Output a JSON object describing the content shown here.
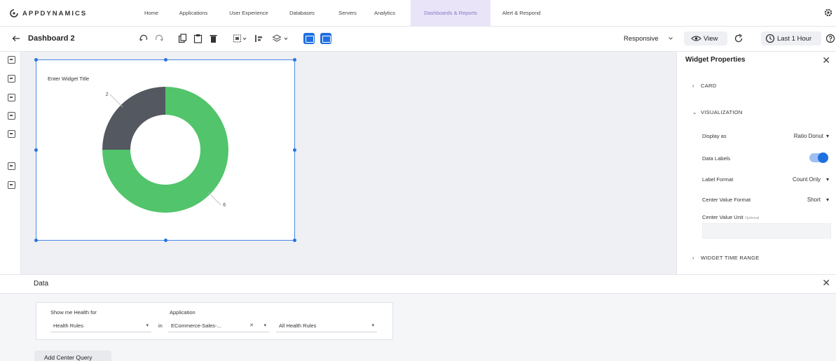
{
  "app": {
    "logo_text": "APPDYNAMICS",
    "nav": [
      {
        "label": "Home"
      },
      {
        "label": "Applications"
      },
      {
        "label": "User Experience"
      },
      {
        "label": "Databases"
      },
      {
        "label": "Servers"
      },
      {
        "label": "Analytics"
      },
      {
        "label": "Dashboards & Reports",
        "active": true
      },
      {
        "label": "Alert & Respond"
      }
    ]
  },
  "toolbar": {
    "back_icon": "arrow-left-icon",
    "title": "Dashboard 2",
    "responsive_label": "Responsive",
    "view_label": "View",
    "time_label": "Last 1 Hour",
    "accent": "#1f6fe0"
  },
  "widget": {
    "title": "Enter Widget Title",
    "colors": {
      "dark": "#545860",
      "green": "#52c46c"
    }
  },
  "chart_data": {
    "type": "pie",
    "variant": "donut",
    "slices": [
      {
        "label": "2",
        "value": 2,
        "color": "#545860"
      },
      {
        "label": "6",
        "value": 6,
        "color": "#52c46c"
      }
    ]
  },
  "properties": {
    "title": "Widget Properties",
    "card_label": "CARD",
    "visualization_label": "VISUALIZATION",
    "display_as_label": "Display as",
    "display_as_value": "Ratio Donut",
    "data_labels_label": "Data Labels",
    "data_labels_on": true,
    "label_format_label": "Label Format",
    "label_format_value": "Count Only",
    "center_value_format_label": "Center Value Format",
    "center_value_format_value": "Short",
    "center_value_unit_label": "Center Value Unit",
    "center_value_unit_optional": "Optional",
    "time_range_label": "WIDGET TIME RANGE"
  },
  "data_panel": {
    "title": "Data",
    "show_me_label": "Show me Health for",
    "show_me_value": "Health Rules",
    "in_label": "in",
    "application_label": "Application",
    "application_value": "ECommerce-Sales-...",
    "health_rules_value": "All Health Rules",
    "add_button": "Add Center Query"
  }
}
